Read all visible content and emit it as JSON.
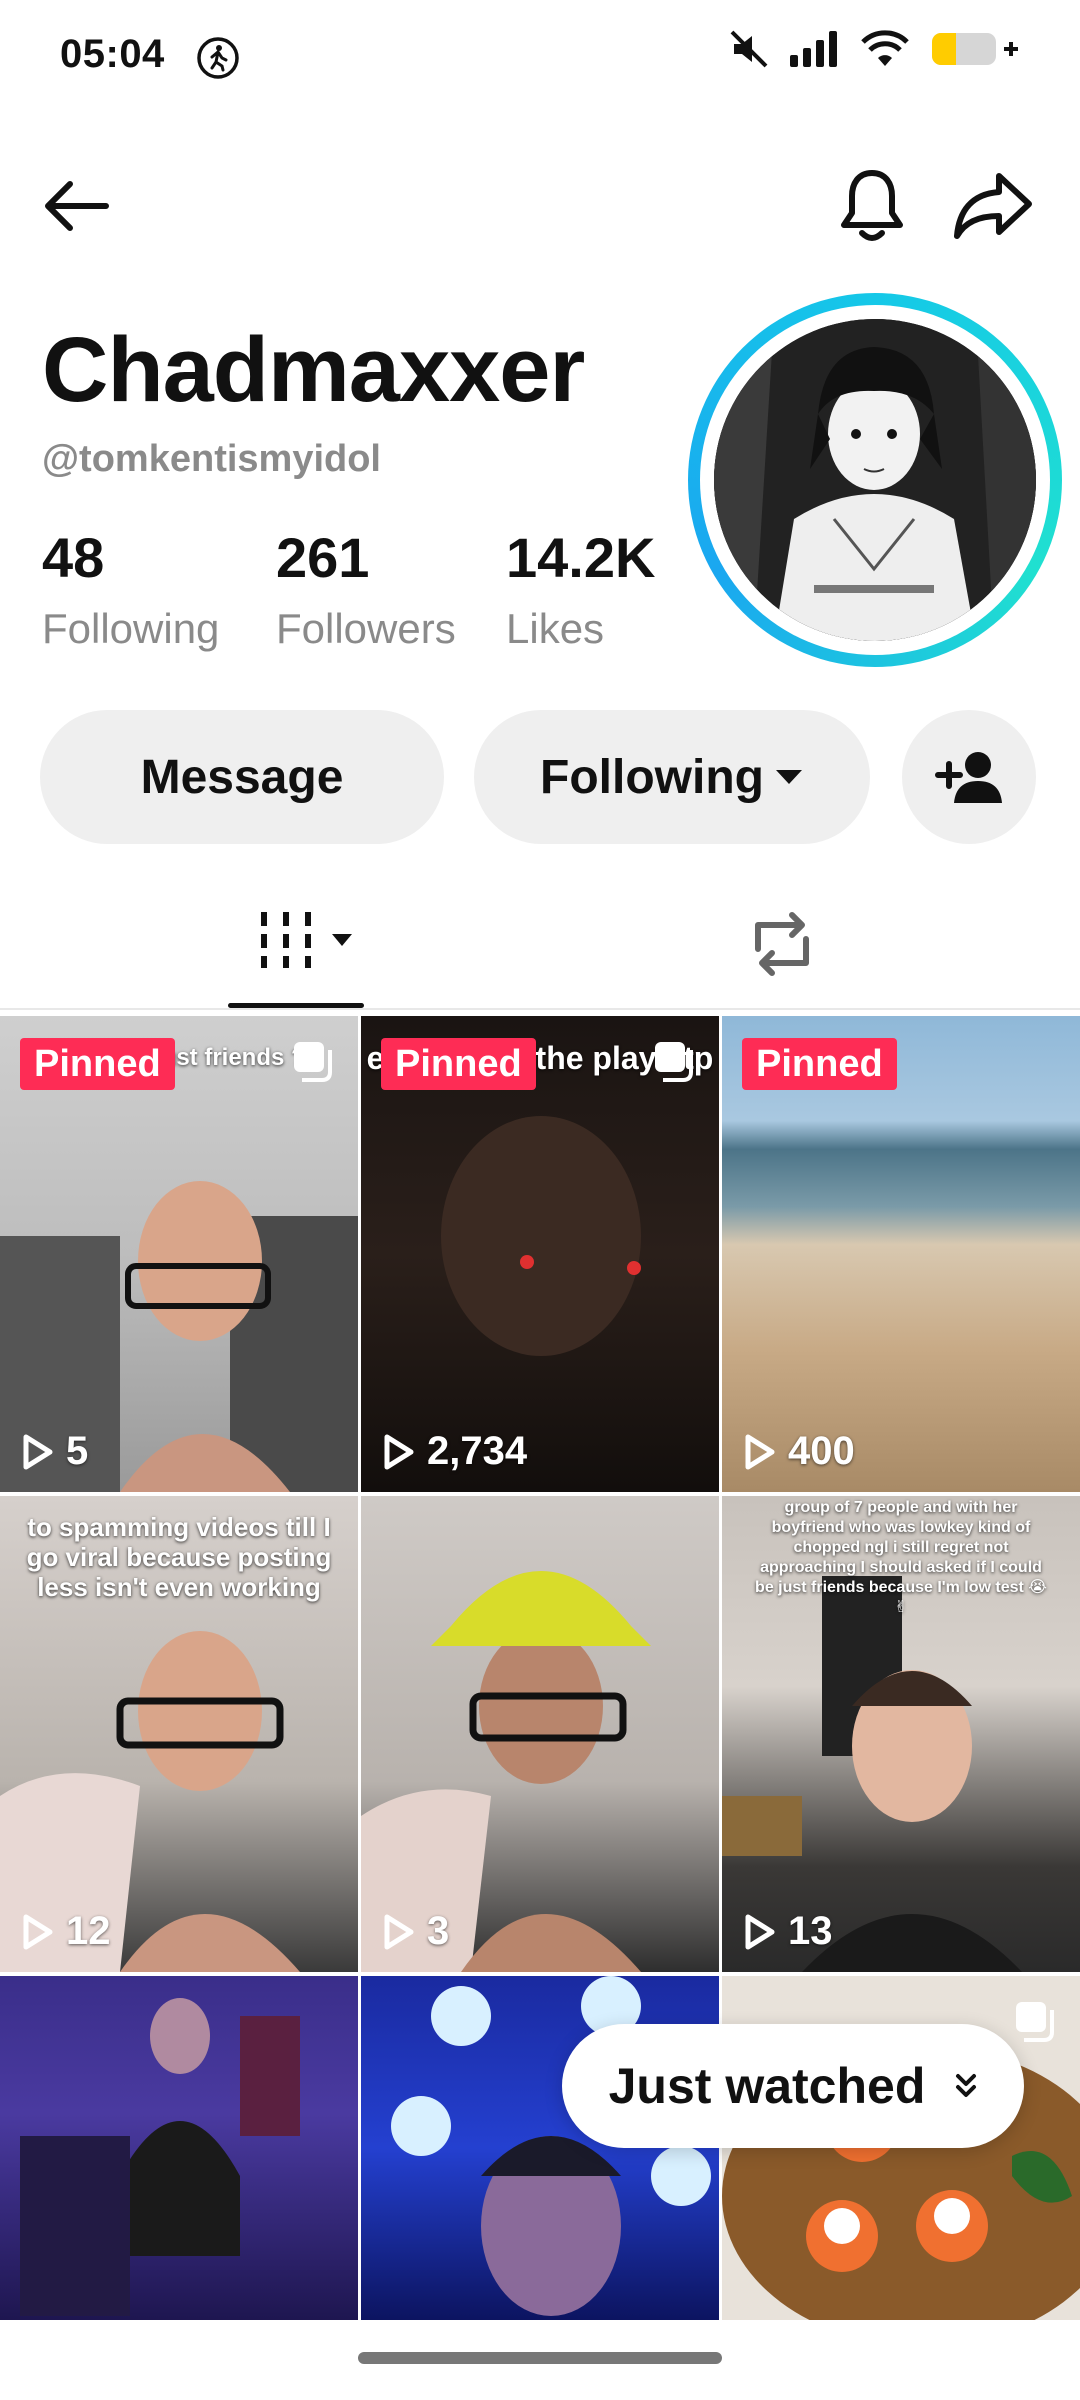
{
  "status": {
    "time": "05:04",
    "battery_color": "#ffcc00"
  },
  "header": {
    "back_icon": "back-arrow-icon",
    "bell_icon": "bell-icon",
    "share_icon": "share-icon"
  },
  "profile": {
    "display_name": "Chadmaxxer",
    "username": "@tomkentismyidol",
    "stats": [
      {
        "value": "48",
        "label": "Following"
      },
      {
        "value": "261",
        "label": "Followers"
      },
      {
        "value": "14.2K",
        "label": "Likes"
      }
    ],
    "ring_color": "#15c8e8"
  },
  "actions": {
    "message": "Message",
    "following": "Following",
    "add_friend_icon": "add-user-icon"
  },
  "tabs": {
    "videos_icon": "grid-icon",
    "reposts_icon": "repost-icon"
  },
  "grid": [
    {
      "pinned": "Pinned",
      "views": "5",
      "overlay": "ls like to just friends ?",
      "multi": true
    },
    {
      "pinned": "Pinned",
      "views": "2,734",
      "overlay": "e ng mi t b the play atp",
      "multi": true
    },
    {
      "pinned": "Pinned",
      "views": "400",
      "overlay": "",
      "multi": false
    },
    {
      "pinned": "",
      "views": "12",
      "overlay": "to spamming videos till I go viral because posting less isn't even working",
      "multi": false
    },
    {
      "pinned": "",
      "views": "3",
      "overlay": "",
      "multi": false
    },
    {
      "pinned": "",
      "views": "13",
      "overlay": "group of 7 people and with her boyfriend who was lowkey kind of chopped ngl i still regret not approaching I should asked if I could be just friends because I'm low test 😭✌",
      "multi": false
    },
    {
      "pinned": "",
      "views": "",
      "overlay": "",
      "multi": false
    },
    {
      "pinned": "",
      "views": "",
      "overlay": "",
      "multi": false
    },
    {
      "pinned": "",
      "views": "",
      "overlay": "",
      "multi": true
    }
  ],
  "just_watched": "Just watched",
  "pinned_color": "#fe2c55"
}
